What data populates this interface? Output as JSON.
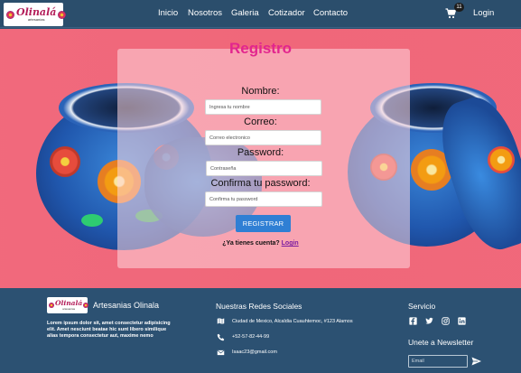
{
  "brand": {
    "logo_title": "Olinalá",
    "logo_subtitle": "artesanías"
  },
  "nav": {
    "links": [
      "Inicio",
      "Nosotros",
      "Galeria",
      "Cotizador",
      "Contacto"
    ],
    "cart_icon": "shopping-cart-icon",
    "cart_count": "11",
    "login_label": "Login"
  },
  "form": {
    "title": "Registro",
    "name_label": "Nombre:",
    "name_placeholder": "Ingresa tu nombre",
    "email_label": "Correo:",
    "email_placeholder": "Correo electronico",
    "password_label": "Password:",
    "password_placeholder": "Contraseña",
    "confirm_label": "Confirma tu password:",
    "confirm_placeholder": "Confirma tu password",
    "submit_label": "REGISTRAR",
    "account_prompt": "¿Ya tienes cuenta?",
    "login_link": "Login"
  },
  "footer": {
    "brand_name": "Artesanias Olinala",
    "description": "Lorem ipsum dolor sit, amet consectetur adipisicing elit. Amet nesciunt beatae hic sunt libero similique alias tempora consectetur aut, maxime nemo",
    "social_heading": "Nuestras Redes Sociales",
    "address": "Ciudad de Mexico, Alcaldia Cuauhtemoc, #123 Alamos",
    "phone": "+52-57-82-44-99",
    "email": "Isaac23@gmail.com",
    "service_heading": "Servicio",
    "social_icons": [
      "facebook-icon",
      "twitter-icon",
      "instagram-icon",
      "linkedin-icon"
    ],
    "newsletter_heading": "Unete a Newsletter",
    "newsletter_placeholder": "Email"
  },
  "colors": {
    "nav_bg": "#2b4e6c",
    "hero_bg": "#ef5f73",
    "title_pink": "#e2258e",
    "button_blue": "#2f7fd4",
    "link_purple": "#7b1ca0"
  }
}
